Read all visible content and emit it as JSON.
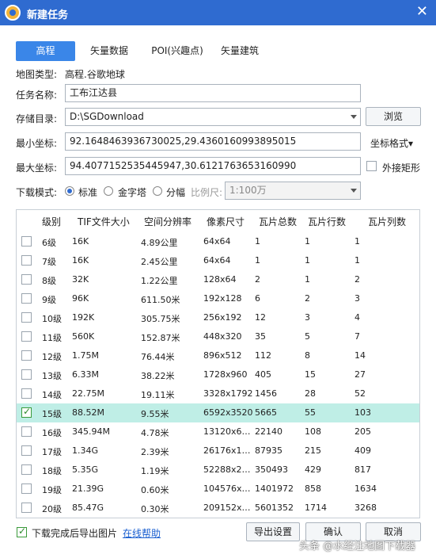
{
  "window": {
    "title": "新建任务",
    "close_glyph": "✕"
  },
  "tabs": [
    {
      "label": "高程",
      "active": true
    },
    {
      "label": "矢量数据",
      "active": false
    },
    {
      "label": "POI(兴趣点)",
      "active": false
    },
    {
      "label": "矢量建筑",
      "active": false
    }
  ],
  "map_type": {
    "label": "地图类型:",
    "value": "高程.谷歌地球"
  },
  "task_name": {
    "label": "任务名称:",
    "value": "工布江达县"
  },
  "storage": {
    "label": "存储目录:",
    "value": "D:\\SGDownload",
    "browse_label": "浏览"
  },
  "min_coord": {
    "label": "最小坐标:",
    "value": "92.1648463936730025,29.4360160993895015"
  },
  "coord_format": {
    "label": "坐标格式▾"
  },
  "max_coord": {
    "label": "最大坐标:",
    "value": "94.4077152535445947,30.6121763653160990"
  },
  "outer_rect": {
    "label": "外接矩形",
    "checked": false
  },
  "download_mode": {
    "label": "下载模式:",
    "options": [
      {
        "label": "标准",
        "checked": true
      },
      {
        "label": "金字塔",
        "checked": false
      },
      {
        "label": "分幅",
        "checked": false
      }
    ],
    "scale_label": "比例尺:",
    "scale_value": "1:100万"
  },
  "table": {
    "headers": [
      "级别",
      "TIF文件大小",
      "空间分辨率",
      "像素尺寸",
      "瓦片总数",
      "瓦片行数",
      "瓦片列数"
    ],
    "rows": [
      {
        "checked": false,
        "level": "6级",
        "size": "16K",
        "res": "4.89公里",
        "px": "64x64",
        "total": "1",
        "rows": "1",
        "cols": "1"
      },
      {
        "checked": false,
        "level": "7级",
        "size": "16K",
        "res": "2.45公里",
        "px": "64x64",
        "total": "1",
        "rows": "1",
        "cols": "1"
      },
      {
        "checked": false,
        "level": "8级",
        "size": "32K",
        "res": "1.22公里",
        "px": "128x64",
        "total": "2",
        "rows": "1",
        "cols": "2"
      },
      {
        "checked": false,
        "level": "9级",
        "size": "96K",
        "res": "611.50米",
        "px": "192x128",
        "total": "6",
        "rows": "2",
        "cols": "3"
      },
      {
        "checked": false,
        "level": "10级",
        "size": "192K",
        "res": "305.75米",
        "px": "256x192",
        "total": "12",
        "rows": "3",
        "cols": "4"
      },
      {
        "checked": false,
        "level": "11级",
        "size": "560K",
        "res": "152.87米",
        "px": "448x320",
        "total": "35",
        "rows": "5",
        "cols": "7"
      },
      {
        "checked": false,
        "level": "12级",
        "size": "1.75M",
        "res": "76.44米",
        "px": "896x512",
        "total": "112",
        "rows": "8",
        "cols": "14"
      },
      {
        "checked": false,
        "level": "13级",
        "size": "6.33M",
        "res": "38.22米",
        "px": "1728x960",
        "total": "405",
        "rows": "15",
        "cols": "27"
      },
      {
        "checked": false,
        "level": "14级",
        "size": "22.75M",
        "res": "19.11米",
        "px": "3328x1792",
        "total": "1456",
        "rows": "28",
        "cols": "52"
      },
      {
        "checked": true,
        "level": "15级",
        "size": "88.52M",
        "res": "9.55米",
        "px": "6592x3520",
        "total": "5665",
        "rows": "55",
        "cols": "103"
      },
      {
        "checked": false,
        "level": "16级",
        "size": "345.94M",
        "res": "4.78米",
        "px": "13120x6…",
        "total": "22140",
        "rows": "108",
        "cols": "205"
      },
      {
        "checked": false,
        "level": "17级",
        "size": "1.34G",
        "res": "2.39米",
        "px": "26176x1…",
        "total": "87935",
        "rows": "215",
        "cols": "409"
      },
      {
        "checked": false,
        "level": "18级",
        "size": "5.35G",
        "res": "1.19米",
        "px": "52288x2…",
        "total": "350493",
        "rows": "429",
        "cols": "817"
      },
      {
        "checked": false,
        "level": "19级",
        "size": "21.39G",
        "res": "0.60米",
        "px": "104576x…",
        "total": "1401972",
        "rows": "858",
        "cols": "1634"
      },
      {
        "checked": false,
        "level": "20级",
        "size": "85.47G",
        "res": "0.30米",
        "px": "209152x…",
        "total": "5601352",
        "rows": "1714",
        "cols": "3268"
      }
    ]
  },
  "footer": {
    "export_after": {
      "label": "下载完成后导出图片",
      "checked": true
    },
    "help_link": "在线帮助",
    "export_settings": "导出设置",
    "ok": "确认",
    "cancel": "取消"
  },
  "watermark": "头条 @水经注地图下载器"
}
